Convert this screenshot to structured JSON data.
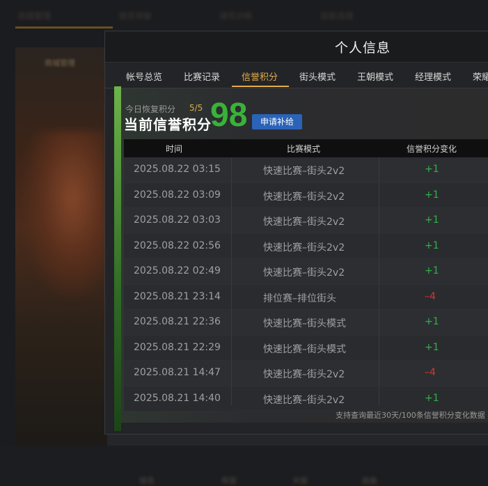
{
  "background": {
    "tabs": [
      "商城管理",
      "球员突破",
      "球员训练",
      "技能选择"
    ],
    "left_card_title": "商城管理",
    "bottom_items": [
      "球员",
      "阵容",
      "天赋",
      "技能"
    ]
  },
  "modal": {
    "title": "个人信息",
    "tabs": [
      "帐号总览",
      "比赛记录",
      "信誉积分",
      "街头模式",
      "王朝模式",
      "经理模式",
      "荣耀"
    ],
    "active_tab": "信誉积分"
  },
  "credit": {
    "today_label": "今日恢复积分",
    "today_value": "5/5",
    "current_label": "当前信誉积分",
    "current_value": "98",
    "apply_button": "申请补给",
    "accent_color": "#39b237"
  },
  "table": {
    "headers": [
      "时间",
      "比赛模式",
      "信誉积分变化"
    ],
    "rows": [
      {
        "time": "2025.08.22  03:15",
        "mode": "快速比赛–街头2v2",
        "delta": "+1"
      },
      {
        "time": "2025.08.22  03:09",
        "mode": "快速比赛–街头2v2",
        "delta": "+1"
      },
      {
        "time": "2025.08.22  03:03",
        "mode": "快速比赛–街头2v2",
        "delta": "+1"
      },
      {
        "time": "2025.08.22  02:56",
        "mode": "快速比赛–街头2v2",
        "delta": "+1"
      },
      {
        "time": "2025.08.22  02:49",
        "mode": "快速比赛–街头2v2",
        "delta": "+1"
      },
      {
        "time": "2025.08.21  23:14",
        "mode": "排位赛–排位街头",
        "delta": "–4"
      },
      {
        "time": "2025.08.21  22:36",
        "mode": "快速比赛–街头模式",
        "delta": "+1"
      },
      {
        "time": "2025.08.21  22:29",
        "mode": "快速比赛–街头模式",
        "delta": "+1"
      },
      {
        "time": "2025.08.21  14:47",
        "mode": "快速比赛–街头2v2",
        "delta": "–4"
      },
      {
        "time": "2025.08.21  14:40",
        "mode": "快速比赛–街头2v2",
        "delta": "+1"
      }
    ],
    "colors": {
      "positive": "#2fb24a",
      "negative": "#d23a2a"
    }
  },
  "footer_note": "支持查询最近30天/100条信誉积分变化数据"
}
